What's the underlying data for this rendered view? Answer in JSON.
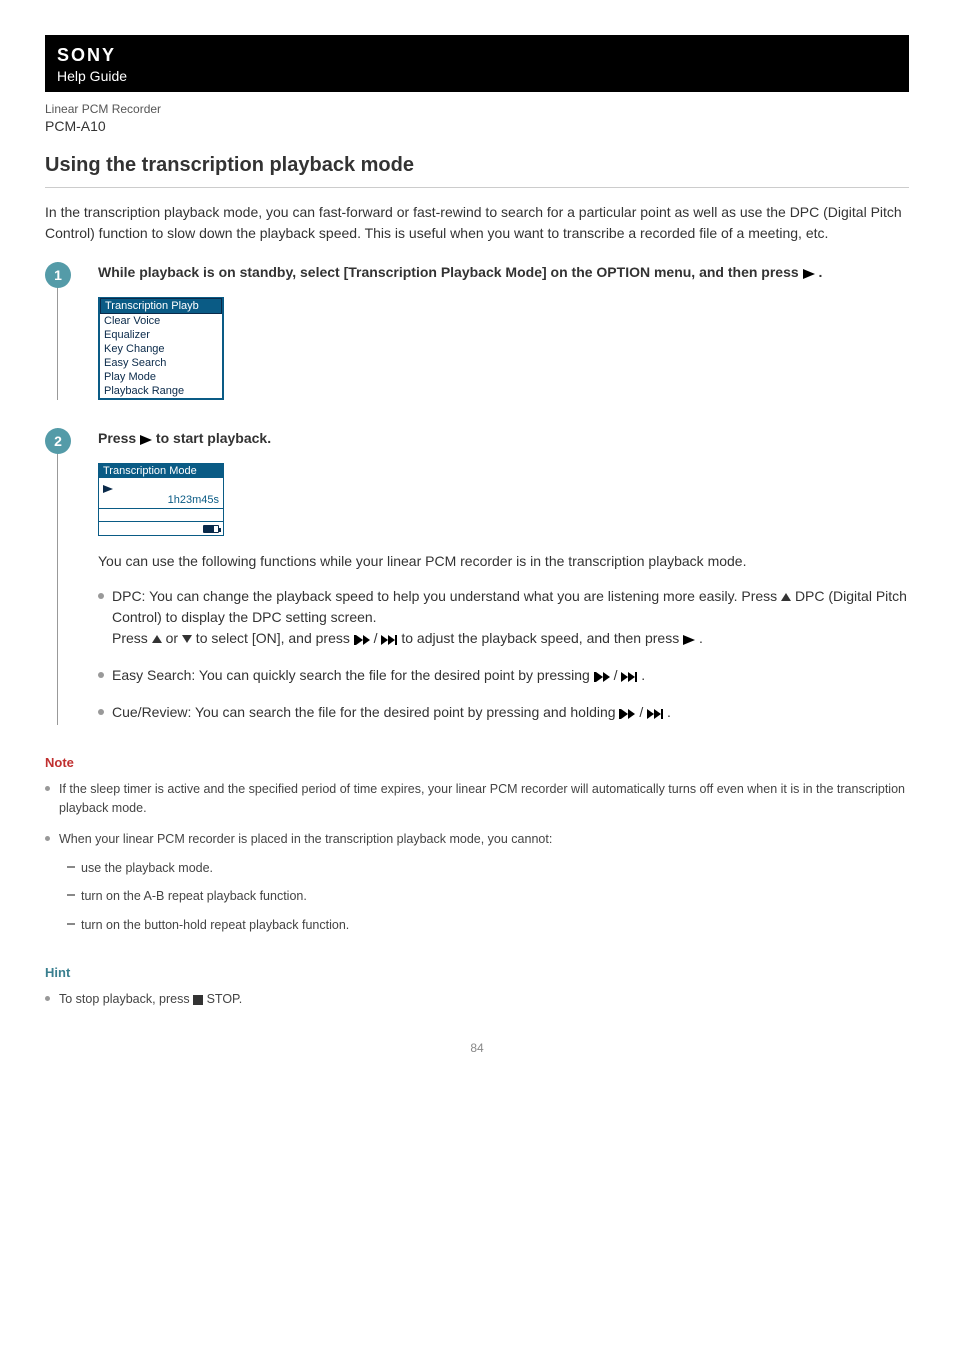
{
  "header": {
    "brand": "SONY",
    "help": "Help Guide",
    "product_line": "Linear PCM Recorder",
    "model": "PCM-A10"
  },
  "title": "Using the transcription playback mode",
  "intro": "In the transcription playback mode, you can fast-forward or fast-rewind to search for a particular point as well as use the DPC (Digital Pitch Control) function to slow down the playback speed. This is useful when you want to transcribe a recorded file of a meeting, etc.",
  "steps": [
    {
      "num": "1",
      "title_before": "While playback is on standby, select [Transcription Playback Mode] on the OPTION menu, and then press ",
      "title_after": " .",
      "menu": [
        "Transcription Playb",
        "Clear Voice",
        "Equalizer",
        "Key Change",
        "Easy Search",
        "Play Mode",
        "Playback Range"
      ]
    },
    {
      "num": "2",
      "title_before": "Press ",
      "title_after": " to start playback.",
      "screen": {
        "title": "Transcription Mode",
        "time": "1h23m45s"
      },
      "body_intro": "You can use the following functions while your linear PCM recorder is in the transcription playback mode.",
      "functions": {
        "dpc_a": "DPC: You can change the playback speed to help you understand what you are listening more easily. Press ",
        "dpc_b": " DPC (Digital Pitch Control) to display the DPC setting screen.",
        "dpc_c1": "Press ",
        "dpc_c2": " or ",
        "dpc_c3": " to select [ON], and press ",
        "dpc_c4": " / ",
        "dpc_c5": " to adjust the playback speed, and then press ",
        "dpc_c6": " .",
        "easy_a": "Easy Search: You can quickly search the file for the desired point by pressing ",
        "easy_b": " / ",
        "easy_c": " .",
        "cue_a": "Cue/Review: You can search the file for the desired point by pressing and holding ",
        "cue_b": " / ",
        "cue_c": " ."
      }
    }
  ],
  "note": {
    "heading": "Note",
    "items": [
      "If the sleep timer is active and the specified period of time expires, your linear PCM recorder will automatically turns off even when it is in the transcription playback mode.",
      "When your linear PCM recorder is placed in the transcription playback mode, you cannot:"
    ],
    "sub": [
      "use the playback mode.",
      "turn on the A-B repeat playback function.",
      "turn on the button-hold repeat playback function."
    ]
  },
  "hint": {
    "heading": "Hint",
    "item_a": "To stop playback, press ",
    "item_b": " STOP."
  },
  "page_number": "84"
}
